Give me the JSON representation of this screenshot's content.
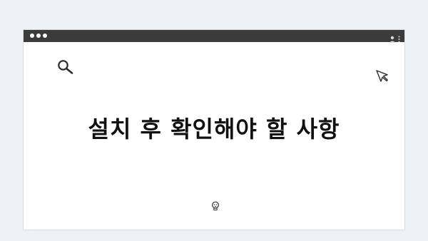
{
  "page": {
    "dots_count": 4,
    "headline": "설치 후 확인해야 할 사항"
  },
  "window": {
    "title_bar_color": "#3b3b3b",
    "controls": [
      "close",
      "minimize",
      "maximize"
    ],
    "right_icons": [
      "user-icon",
      "more-vertical-icon"
    ]
  },
  "icons": {
    "top_left": "search-icon",
    "top_right": "cursor-icon",
    "bottom_center": "lightbulb-icon"
  },
  "colors": {
    "background": "#edf1f6",
    "canvas": "#ffffff",
    "text": "#111111"
  }
}
